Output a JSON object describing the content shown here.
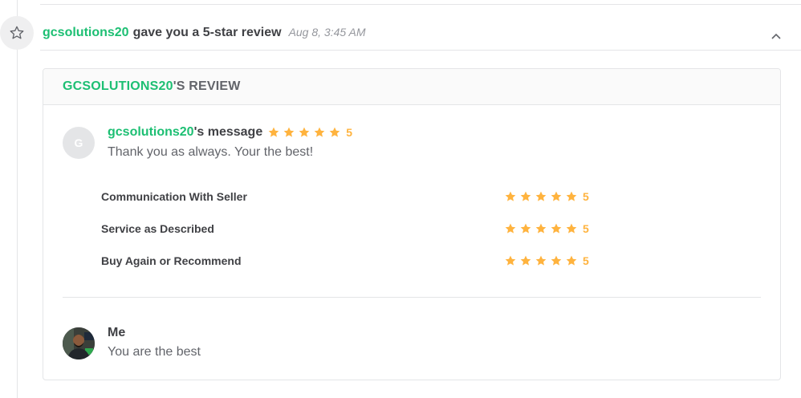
{
  "event": {
    "username": "gcsolutions20",
    "text": "gave you a 5-star review",
    "time": "Aug 8, 3:45 AM"
  },
  "review": {
    "header_username": "GCSOLUTIONS20",
    "header_suffix": "'S REVIEW",
    "avatar_initial": "G",
    "message_username": "gcsolutions20",
    "message_suffix": "'s message",
    "overall_rating": "5",
    "message": "Thank you as always. Your the best!",
    "sub_ratings": [
      {
        "label": "Communication With Seller",
        "value": "5"
      },
      {
        "label": "Service as Described",
        "value": "5"
      },
      {
        "label": "Buy Again or Recommend",
        "value": "5"
      }
    ]
  },
  "reply": {
    "name": "Me",
    "text": "You are the best"
  },
  "colors": {
    "brand_green": "#1dbf73",
    "star_orange": "#ffb33e",
    "border": "#e4e5e7"
  }
}
